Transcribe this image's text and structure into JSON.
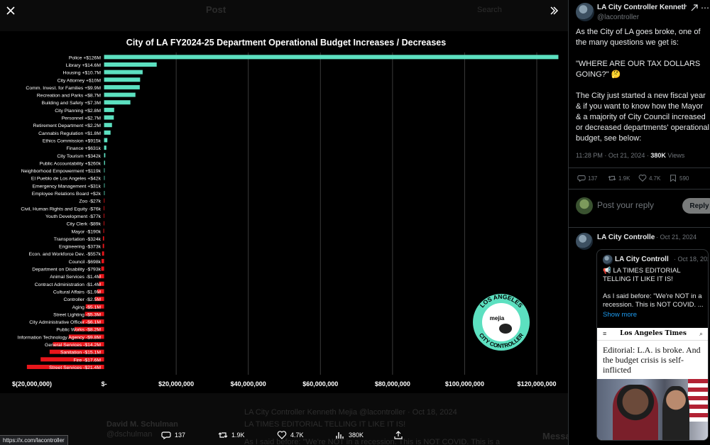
{
  "viewer": {
    "close_icon": "close-icon",
    "collapse_icon": "chevron-double-right-icon",
    "ghost": {
      "post_label": "Post",
      "search_placeholder": "Search",
      "author_name": "David M. Schulman",
      "author_handle": "@dschulman",
      "quoted_line": "LA City Controller Kenneth Mejia  @lacontroller · Oct 18, 2024",
      "quoted_text": "LA TIMES EDITORIAL TELLING IT LIKE IT IS!",
      "quoted_text2": "As I said before: \"We're NOT in a recession. This is NOT COVID. This is a",
      "messages_label": "Messages"
    },
    "actions": {
      "replies": "137",
      "reposts": "1.9K",
      "likes": "4.7K",
      "views": "380K"
    },
    "status_url": "https://x.com/lacontroller"
  },
  "chart_data": {
    "type": "bar",
    "orientation": "horizontal",
    "title": "City of LA FY2024-25 Department Operational Budget Increases / Decreases",
    "categories": [
      "Police +$126M",
      "Library +$14.6M",
      "Housing +$10.7M",
      "City Attorney +$10M",
      "Comm. Invest. for Families +$9.9M",
      "Recreation and Parks +$8.7M",
      "Building and Safety +$7.3M",
      "City Planning +$2.8M",
      "Personnel +$2.7M",
      "Retirement Department +$2.2M",
      "Cannabis Regulation +$1.8M",
      "Ethics Commission +$915k",
      "Finance +$631k",
      "City Tourism +$342k",
      "Public Accountability +$260k",
      "Neighborhood Empowerment +$119k",
      "El Pueblo de Los Angeles +$42k",
      "Emergency Management +$31k",
      "Employee Relations Board +$2k",
      "Zoo -$27k",
      "Civil, Human Rights and Equity -$76k",
      "Youth Development -$77k",
      "City Clerk -$89k",
      "Mayor -$190k",
      "Transportation -$324k",
      "Engineering -$373k",
      "Econ. and Workforce Dev. -$557k",
      "Council -$698k",
      "Department on Disability -$793k",
      "Animal Services -$1.4M",
      "Contract Administration -$1.4M",
      "Cultural Affairs -$1.9M",
      "Controller -$2.5M",
      "Aging -$5.1M",
      "Street Lighting -$5.3M",
      "City Administrative Officer -$6.1M",
      "Public Works -$8.2M",
      "Information Technology Agency -$9.8M",
      "General Services -$14.2M",
      "Sanitation -$15.1M",
      "Fire -$17.6M",
      "Street Services -$21.4M"
    ],
    "values": [
      126000000,
      14600000,
      10700000,
      10000000,
      9900000,
      8700000,
      7300000,
      2800000,
      2700000,
      2200000,
      1800000,
      915000,
      631000,
      342000,
      260000,
      119000,
      42000,
      31000,
      2000,
      -27000,
      -76000,
      -77000,
      -89000,
      -190000,
      -324000,
      -373000,
      -557000,
      -698000,
      -793000,
      -1400000,
      -1400000,
      -1900000,
      -2500000,
      -5100000,
      -5300000,
      -6100000,
      -8200000,
      -9800000,
      -14200000,
      -15100000,
      -17600000,
      -21400000
    ],
    "x_tick_labels": [
      "$(20,000,000)",
      "$-",
      "$20,000,000",
      "$40,000,000",
      "$60,000,000",
      "$80,000,000",
      "$100,000,000",
      "$120,000,000"
    ],
    "x_ticks": [
      -20000000,
      0,
      20000000,
      40000000,
      60000000,
      80000000,
      100000000,
      120000000
    ],
    "xlim": [
      -20000000,
      126000000
    ],
    "grid": true,
    "colors": {
      "positive": "#5ce0c0",
      "negative": "#e8161b",
      "background": "#000000"
    },
    "logo": {
      "ring_top": "LOS ANGELES",
      "ring_bottom": "CITY CONTROLLER",
      "center": "mejia",
      "color": "#5ce0c0"
    }
  },
  "tweet": {
    "name": "LA City Controller Kenneth Mejia",
    "handle": "@lacontroller",
    "grok_icon": "grok-icon",
    "more_icon": "more-icon",
    "text": [
      "As the City of LA goes broke, one of the many questions we get is:",
      "\"WHERE ARE OUR TAX DOLLARS GOING?\" 🤔",
      "The City just started a new fiscal year & if you want to know how the Mayor & a majority of City Council increased or decreased departments' operational budget, see below:"
    ],
    "time": "11:28 PM · Oct 21, 2024 · ",
    "views_count": "380K",
    "views_label": " Views",
    "stats": {
      "replies": "137",
      "reposts": "1.9K",
      "likes": "4.7K",
      "bookmarks": "590"
    },
    "reply_placeholder": "Post your reply",
    "reply_button": "Reply"
  },
  "reply": {
    "name": "LA City Controlle",
    "date": "· Oct 21, 2024",
    "quote": {
      "name": "LA City Controll",
      "date": "· Oct 18, 202",
      "text": [
        "📢 LA TIMES EDITORIAL TELLING IT LIKE IT IS!",
        "As I said before: \"We're NOT in a recession. This is NOT COVID. ..."
      ],
      "show_more": "Show more",
      "article": {
        "brand": "Los Angeles Times",
        "headline": "Editorial: L.A. is broke. And the budget crisis is self-inflicted"
      }
    }
  }
}
